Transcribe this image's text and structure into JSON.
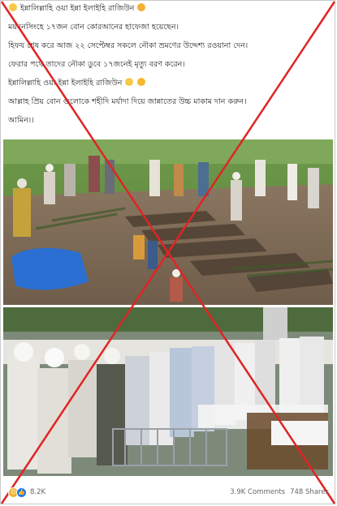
{
  "post": {
    "lines": [
      "ইন্নালিল্লাহি ওয়া ইন্না ইলাইহি রাজিউন",
      "ময়মনসিংহে ১৭জন বোন কোরআনের হাফেজা হয়েছেন।",
      "হিফয শেষ করে আজ ২২ সেপ্টেম্বর সকলে নৌকা ভ্রমণের উদ্দেশ্য রওয়ানা দেন।",
      "ফেরার পথে তাদের নৌকা ডুবে ১৭জনেই মৃত্যু বরণ করেন।",
      "ইন্নালিল্লাহি ওয়া ইন্না ইলাইহি রাজিউন",
      "আল্লাহ প্রিয় বোন গুলোকে শহীদি মর্যাদা দিয়ে জান্নাতের উচ্চ মাকাম দান করুন।",
      "আমিন।।"
    ]
  },
  "photos": {
    "top": {
      "icon": "photo-graves-digging"
    },
    "bottom": {
      "icon": "photo-funeral-prayer"
    }
  },
  "footer": {
    "reaction_count": "8.2K",
    "comments": "3.9K Comments",
    "shares": "748 Shares"
  },
  "colors": {
    "fact_check_cross": "#e02424",
    "text": "#1c1e21",
    "muted": "#65676b",
    "like_blue": "#1877f2"
  }
}
